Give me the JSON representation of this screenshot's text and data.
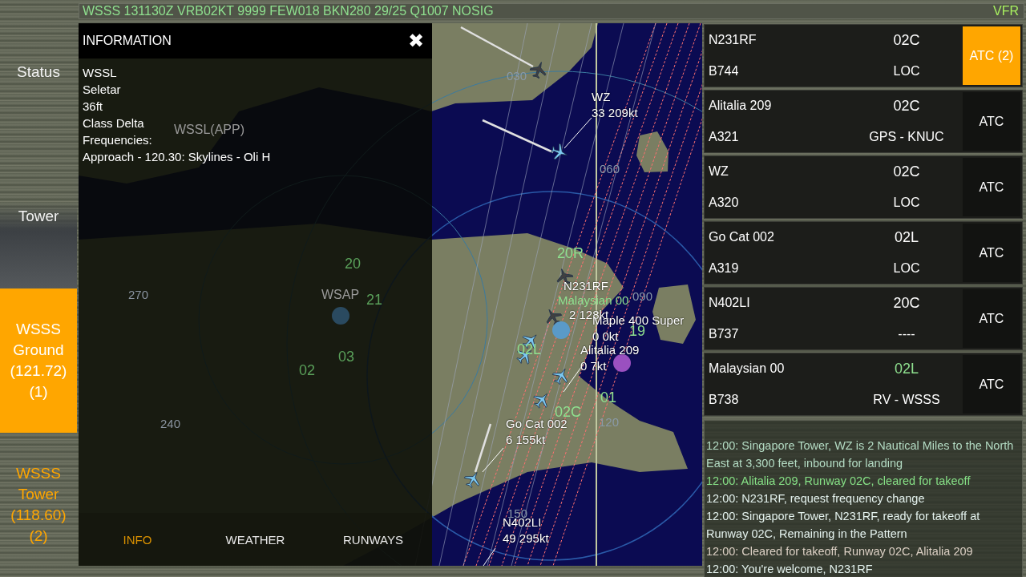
{
  "metar": {
    "text": "WSSS 131130Z VRB02KT 9999 FEW018 BKN280 29/25 Q1007 NOSIG",
    "flight_rules": "VFR"
  },
  "sidebar": {
    "items": [
      {
        "lines": [
          "Status"
        ],
        "selected": false,
        "alert": false
      },
      {
        "lines": [
          "Tower"
        ],
        "selected": false,
        "alert": false
      },
      {
        "lines": [
          "WSSS",
          "Ground",
          "(121.72)",
          "(1)"
        ],
        "selected": true,
        "alert": false
      },
      {
        "lines": [
          "WSSS",
          "Tower",
          "(118.60)",
          "(2)"
        ],
        "selected": false,
        "alert": true
      }
    ]
  },
  "info_panel": {
    "title": "INFORMATION",
    "close": "✖",
    "lines": [
      "WSSL",
      "Seletar",
      "36ft",
      "Class Delta",
      "Frequencies:",
      "Approach - 120.30: Skylines - Oli H"
    ],
    "tabs": [
      {
        "label": "INFO",
        "selected": true
      },
      {
        "label": "WEATHER",
        "selected": false
      },
      {
        "label": "RUNWAYS",
        "selected": false
      }
    ]
  },
  "map": {
    "labels": [
      {
        "text": "WSSL(APP)",
        "kind": "airport"
      },
      {
        "text": "20",
        "kind": "runway_faded"
      },
      {
        "text": "270",
        "kind": "bearing_faded"
      },
      {
        "text": "WSAP",
        "kind": "airport"
      },
      {
        "text": "21",
        "kind": "runway_faded"
      },
      {
        "text": "03",
        "kind": "runway_faded"
      },
      {
        "text": "02",
        "kind": "runway_faded"
      },
      {
        "text": "240",
        "kind": "bearing_faded"
      },
      {
        "text": "030",
        "kind": "bearing"
      },
      {
        "text": "WZ",
        "kind": "tag"
      },
      {
        "text": "33 209kt",
        "kind": "tag"
      },
      {
        "text": "060",
        "kind": "bearing"
      },
      {
        "text": "20R",
        "kind": "runway"
      },
      {
        "text": "N231RF",
        "kind": "tag"
      },
      {
        "text": "Malaysian 00",
        "kind": "tag_cleared"
      },
      {
        "text": "2 128kt",
        "kind": "tag"
      },
      {
        "text": "090",
        "kind": "bearing"
      },
      {
        "text": "Maple 400 Super",
        "kind": "tag"
      },
      {
        "text": "0 0kt",
        "kind": "tag"
      },
      {
        "text": "19",
        "kind": "runway"
      },
      {
        "text": "Alitalia 209",
        "kind": "tag"
      },
      {
        "text": "0 7kt",
        "kind": "tag"
      },
      {
        "text": "02L",
        "kind": "runway"
      },
      {
        "text": "01",
        "kind": "runway"
      },
      {
        "text": "02C",
        "kind": "runway"
      },
      {
        "text": "Go Cat 002",
        "kind": "tag"
      },
      {
        "text": "120",
        "kind": "bearing"
      },
      {
        "text": "6 155kt",
        "kind": "tag"
      },
      {
        "text": "150",
        "kind": "bearing"
      },
      {
        "text": "N402LI",
        "kind": "tag"
      },
      {
        "text": "49 295kt",
        "kind": "tag"
      }
    ],
    "aircraft": [
      {
        "color": "#404040"
      },
      {
        "color": "#7cc8f0"
      },
      {
        "color": "#404040"
      },
      {
        "color": "#404040"
      },
      {
        "color": "#7cc8f0"
      },
      {
        "color": "#7cc8f0"
      },
      {
        "color": "#7cc8f0"
      },
      {
        "color": "#7cc8f0"
      },
      {
        "color": "#7cc8f0"
      }
    ],
    "airports": [
      {
        "color": "#2a4a60"
      },
      {
        "color": "#5a9ac8"
      },
      {
        "color": "#9a50c0"
      }
    ]
  },
  "strips": [
    {
      "callsign": "N231RF",
      "type": "B744",
      "runway": "02C",
      "route": "LOC",
      "cleared": false,
      "atc": "ATC (2)",
      "alert": true
    },
    {
      "callsign": "Alitalia 209",
      "type": "A321",
      "runway": "02C",
      "route": "GPS - KNUC",
      "cleared": false,
      "atc": "ATC",
      "alert": false
    },
    {
      "callsign": "WZ",
      "type": "A320",
      "runway": "02C",
      "route": "LOC",
      "cleared": false,
      "atc": "ATC",
      "alert": false
    },
    {
      "callsign": "Go Cat 002",
      "type": "A319",
      "runway": "02L",
      "route": "LOC",
      "cleared": false,
      "atc": "ATC",
      "alert": false
    },
    {
      "callsign": "N402LI",
      "type": "B737",
      "runway": "20C",
      "route": "----",
      "cleared": false,
      "atc": "ATC",
      "alert": false
    },
    {
      "callsign": "Malaysian 00",
      "type": "B738",
      "runway": "02L",
      "route": "RV - WSSS",
      "cleared": true,
      "atc": "ATC",
      "alert": false
    }
  ],
  "log": [
    {
      "text": "12:00: Singapore  Tower, WZ is 2 Nautical Miles to the North East at 3,300 feet, inbound for landing",
      "color": "#b4dcc4"
    },
    {
      "text": "12:00: Alitalia 209, Runway 02C, cleared for takeoff",
      "color": "#86e086"
    },
    {
      "text": "12:00: N231RF, request frequency change",
      "color": "#e4f2ee"
    },
    {
      "text": "12:00: Singapore  Tower, N231RF, ready for takeoff at Runway 02C, Remaining in the Pattern",
      "color": "#e4f2ee"
    },
    {
      "text": "12:00: Cleared for takeoff, Runway 02C, Alitalia 209",
      "color": "#dcd0c4"
    },
    {
      "text": "12:00: You're welcome, N231RF",
      "color": "#e4f2ee"
    }
  ]
}
